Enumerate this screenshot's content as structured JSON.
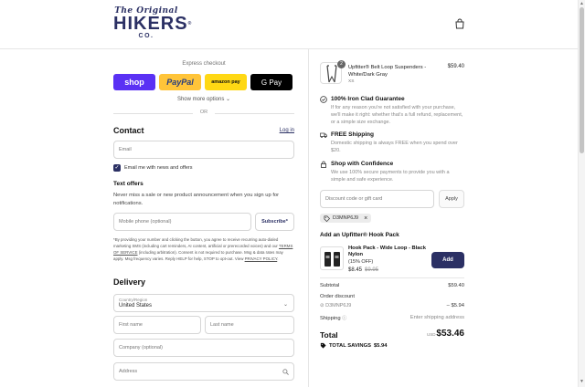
{
  "brand": {
    "line1": "The Original",
    "line2": "HIKERS",
    "reg": "®",
    "line3": "CO."
  },
  "express": {
    "label": "Express checkout",
    "buttons": {
      "shop": "shop",
      "paypal": "PayPal",
      "amazon": "amazon pay",
      "gpay": "G Pay"
    },
    "show_more": "Show more options ⌄",
    "or": "OR"
  },
  "contact": {
    "heading": "Contact",
    "login": "Log in",
    "email_placeholder": "Email",
    "newsletter_label": "Email me with news and offers"
  },
  "text_offers": {
    "heading": "Text offers",
    "description": "Never miss a sale or new product announcement when you sign up for notifications.",
    "phone_placeholder": "Mobile phone (optional)",
    "subscribe": "Subscribe*",
    "legal_1": "*By providing your number and clicking the button, you agree to receive recurring auto-dialed marketing SMS (including cart reminders, AI content, artificial or prerecorded voices) and our ",
    "legal_tos": "TERMS OF SERVICE",
    "legal_2": " (including arbitration). Consent is not required to purchase. Msg & data rates may apply. Msg frequency varies. Reply HELP for help, STOP to opt-out. View ",
    "legal_privacy": "PRIVACY POLICY",
    "legal_3": "."
  },
  "delivery": {
    "heading": "Delivery",
    "country_label": "Country/Region",
    "country_value": "United States",
    "first_name": "First name",
    "last_name": "Last name",
    "company": "Company (optional)",
    "address": "Address"
  },
  "cart": {
    "item": {
      "name": "Upfitter® Belt Loop Suspenders - White/Dark Gray",
      "variant": "XS",
      "qty": "2",
      "price": "$59.40"
    },
    "features": [
      {
        "title": "100% Iron Clad Guarantee",
        "desc": "If for any reason you're not satisfied with your purchase, we'll make it right: whether that's a full refund, replacement, or a simple size exchange."
      },
      {
        "title": "FREE Shipping",
        "desc": "Domestic shipping is always FREE when you spend over $20."
      },
      {
        "title": "Shop with Confidence",
        "desc": "We use 100% secure payments to provide you with a simple and safe experience."
      }
    ],
    "discount_placeholder": "Discount code or gift card",
    "apply": "Apply",
    "code": "D3MNP6J9",
    "addon": {
      "heading": "Add an Upfitter® Hook Pack",
      "name": "Hook Pack - Wide Loop - Black Nylon",
      "off": "(15% OFF)",
      "price": "$8.45",
      "old_price": "$9.95",
      "button": "Add"
    },
    "summary": {
      "subtotal_label": "Subtotal",
      "subtotal": "$59.40",
      "order_discount_label": "Order discount",
      "discount_code": "D3MNP6J9",
      "discount": "– $5.94",
      "shipping_label": "Shipping",
      "shipping_value": "Enter shipping address",
      "total_label": "Total",
      "currency": "USD",
      "total": "$53.46",
      "savings_label": "TOTAL SAVINGS",
      "savings": "$5.94"
    }
  }
}
